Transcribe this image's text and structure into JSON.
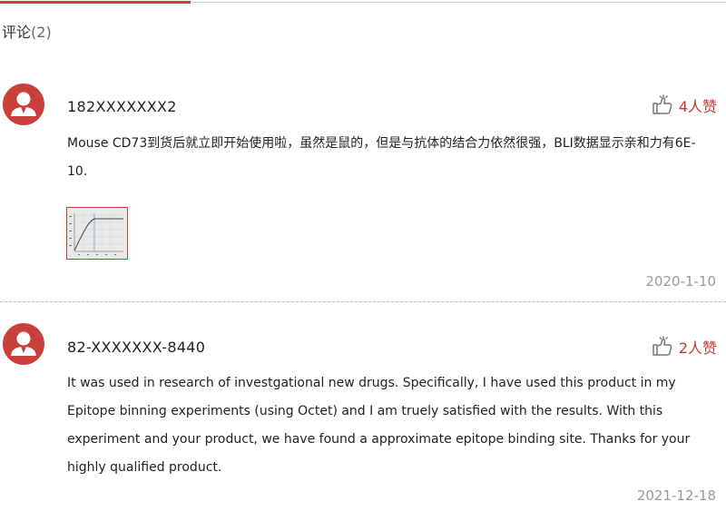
{
  "section": {
    "title": "评论",
    "count": "(2)"
  },
  "comments": [
    {
      "username": "182XXXXXXX2",
      "likes": "4人赞",
      "text": "Mouse CD73到货后就立即开始使用啦，虽然是鼠的，但是与抗体的结合力依然很强，BLI数据显示亲和力有6E-10.",
      "date": "2020-1-10",
      "has_image": true
    },
    {
      "username": "82-XXXXXXX-8440",
      "likes": "2人赞",
      "text": "It was used in research of investgational new drugs. Specifically, I have used this product in my Epitope binning experiments (using Octet) and I am truely satisfied with the results. With this experiment and your product, we have found a approximate epitope binding site. Thanks for your highly qualified product.",
      "date": "2021-12-18",
      "has_image": false
    }
  ],
  "colors": {
    "accent": "#c9403a",
    "date": "#9a9a9a",
    "like": "#c33a35"
  },
  "icons": {
    "avatar": "user-avatar-icon",
    "like": "thumbs-up-icon"
  }
}
